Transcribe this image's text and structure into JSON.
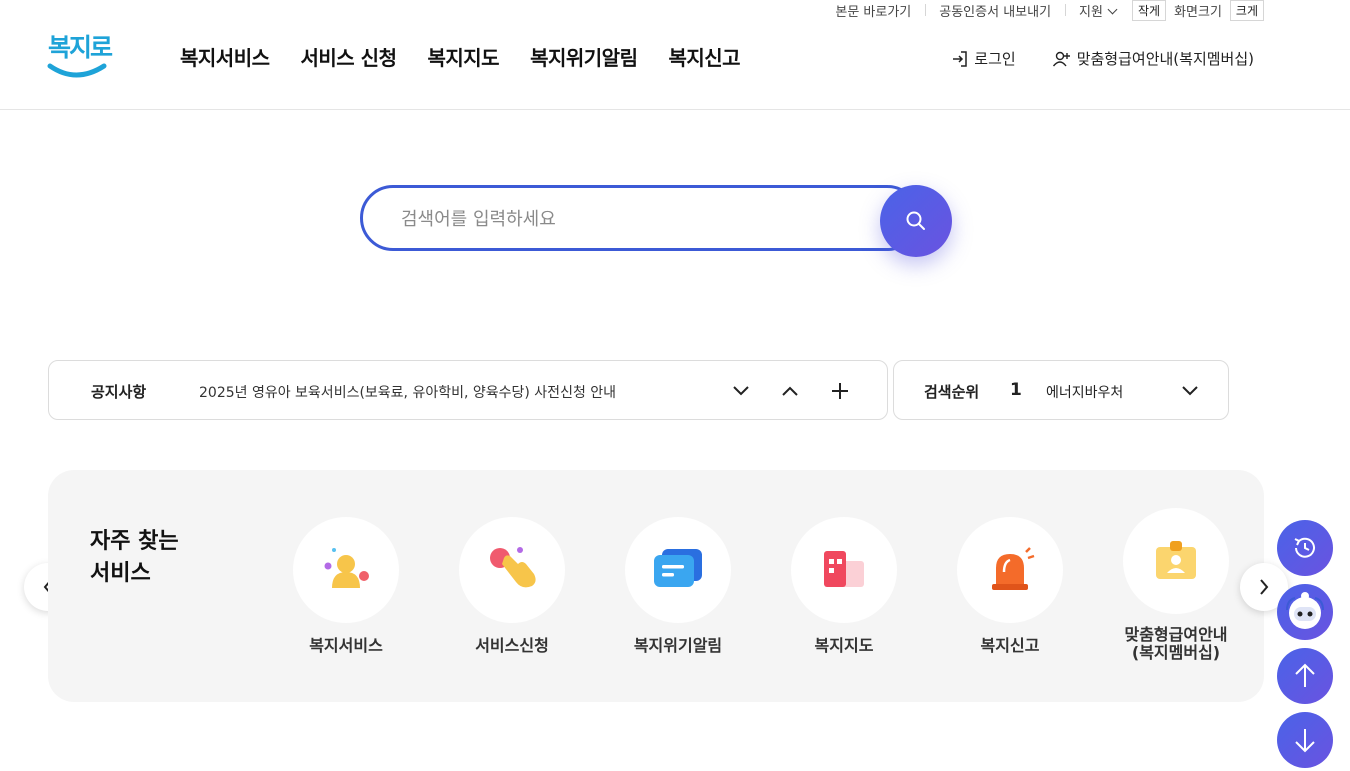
{
  "utility": {
    "skip_link": "본문 바로가기",
    "cert_export": "공동인증서 내보내기",
    "support": "지원",
    "font_small": "작게",
    "font_label": "화면크기",
    "font_large": "크게"
  },
  "logo": {
    "text": "복지로"
  },
  "gnb": [
    "복지서비스",
    "서비스 신청",
    "복지지도",
    "복지위기알림",
    "복지신고"
  ],
  "header_right": {
    "login": "로그인",
    "membership": "맞춤형급여안내(복지멤버십)"
  },
  "search": {
    "placeholder": "검색어를 입력하세요"
  },
  "notice": {
    "label": "공지사항",
    "text": "2025년 영유아 보육서비스(보육료, 유아학비, 양육수당) 사전신청 안내"
  },
  "rank": {
    "label": "검색순위",
    "number": "1",
    "keyword": "에너지바우처"
  },
  "frequent": {
    "title_line1": "자주 찾는",
    "title_line2": "서비스",
    "items": [
      {
        "label": "복지서비스",
        "icon": "person-icon"
      },
      {
        "label": "서비스신청",
        "icon": "hand-touch-icon"
      },
      {
        "label": "복지위기알림",
        "icon": "message-icon"
      },
      {
        "label": "복지지도",
        "icon": "map-icon"
      },
      {
        "label": "복지신고",
        "icon": "siren-icon"
      },
      {
        "label": "맞춤형급여안내\n(복지멤버십)",
        "icon": "membership-card-icon"
      }
    ]
  },
  "colors": {
    "accent": "#3c5ad6",
    "accent2": "#6a53e0",
    "logo": "#1ea3d8"
  }
}
